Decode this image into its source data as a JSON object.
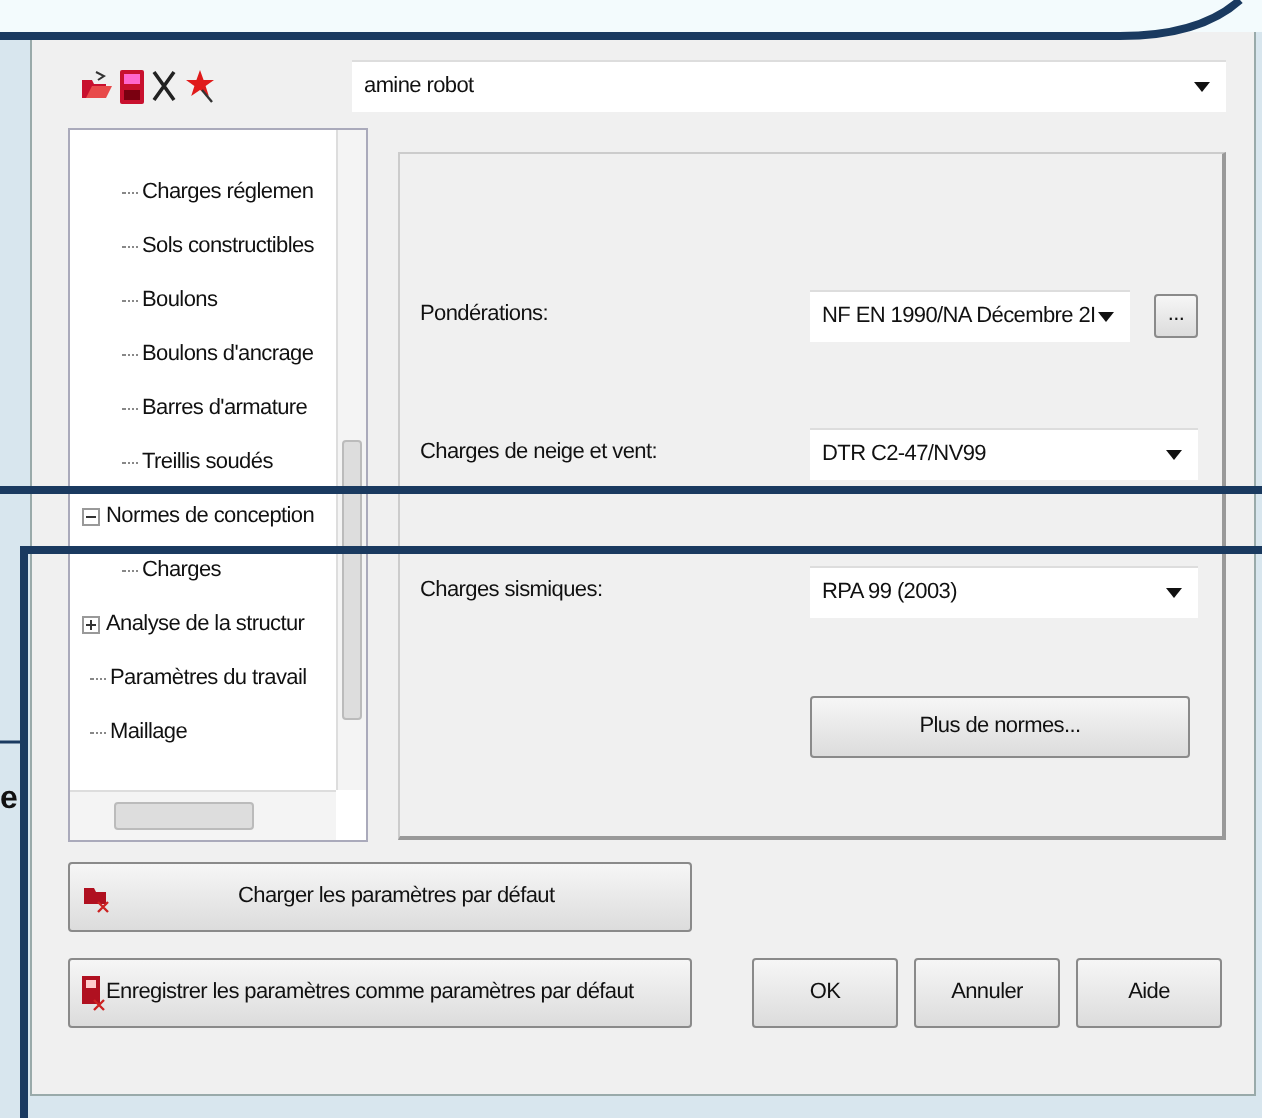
{
  "toolbar": {
    "preset": "amine robot"
  },
  "tree": {
    "items": [
      {
        "children": [
          {
            "label": "Charges réglemen"
          },
          {
            "label": "Sols constructibles"
          },
          {
            "label": "Boulons"
          },
          {
            "label": "Boulons d'ancrage"
          },
          {
            "label": "Barres d'armature"
          },
          {
            "label": "Treillis soudés"
          }
        ]
      },
      {
        "label": "Normes de conception",
        "expanded": true,
        "children": [
          {
            "label": "Charges"
          }
        ]
      },
      {
        "label": "Analyse de la structur",
        "expanded": false
      },
      {
        "label": "Paramètres du travail"
      },
      {
        "label": "Maillage"
      }
    ]
  },
  "settings": [
    {
      "label": "Pondérations:",
      "value": "NF EN 1990/NA Décembre 2I",
      "browse": "..."
    },
    {
      "label": "Charges de neige et vent:",
      "value": "DTR C2-47/NV99"
    },
    {
      "label": "Charges sismiques:",
      "value": "RPA 99 (2003)"
    }
  ],
  "more_button": "Plus de normes...",
  "load_defaults": "Charger les paramètres par défaut",
  "save_defaults": "Enregistrer les paramètres comme paramètres par défaut",
  "buttons": [
    "OK",
    "Annuler",
    "Aide"
  ],
  "annotation_fragment": "e"
}
